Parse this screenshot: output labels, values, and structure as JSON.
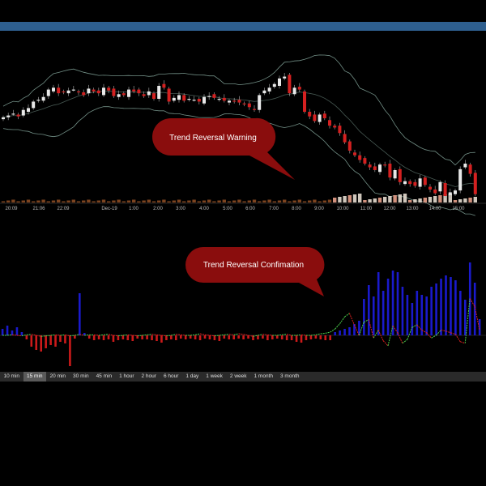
{
  "annotations": {
    "warning": "Trend Reversal Warning",
    "confirmation": "Trend Reversal Confimation"
  },
  "timeframes": [
    "10 min",
    "15 min",
    "20 min",
    "30 min",
    "45 min",
    "1 hour",
    "2 hour",
    "6 hour",
    "1 day",
    "1 week",
    "2 week",
    "1 month",
    "3 month"
  ],
  "selected_timeframe": "15 min",
  "colors": {
    "bull": "#e8e8e8",
    "bear": "#d42020",
    "bands": "#8fb3a8",
    "histogram_pos": "#1a1acc",
    "histogram_neg": "#cc1a1a",
    "signal_up": "#4cd14c",
    "signal_down": "#e02020",
    "callout": "#8a0d0d",
    "top_bar": "#2e5f8f"
  },
  "chart_data": [
    {
      "type": "candlestick",
      "x_tick_labels": [
        "20:09",
        "21:06",
        "22:09",
        "Dec-19",
        "1:00",
        "2:00",
        "3:00",
        "4:00",
        "5:00",
        "6:00",
        "7:00",
        "8:00",
        "9:00",
        "10:00",
        "11:00",
        "12:00",
        "13:00",
        "14:00",
        "15:00"
      ],
      "close": [
        182,
        184,
        186,
        183,
        190,
        192,
        199,
        201,
        204,
        212,
        214,
        208,
        209,
        211,
        212,
        209,
        206,
        213,
        210,
        208,
        214,
        211,
        205,
        207,
        206,
        212,
        210,
        208,
        205,
        210,
        202,
        216,
        214,
        199,
        203,
        206,
        200,
        202,
        201,
        199,
        204,
        205,
        203,
        202,
        200,
        200,
        199,
        198,
        196,
        193,
        190,
        206,
        211,
        214,
        218,
        224,
        226,
        208,
        214,
        212,
        188,
        183,
        178,
        185,
        181,
        173,
        171,
        165,
        155,
        146,
        141,
        136,
        132,
        128,
        125,
        131,
        130,
        117,
        125,
        112,
        113,
        110,
        108,
        116,
        109,
        104,
        100,
        112,
        97,
        101,
        103,
        126,
        132,
        121,
        99
      ],
      "series": [
        {
          "name": "Upper band"
        },
        {
          "name": "Middle band"
        },
        {
          "name": "Lower band"
        }
      ]
    },
    {
      "type": "histogram_with_signal",
      "histogram": [
        8,
        12,
        6,
        10,
        4,
        -5,
        -14,
        -18,
        -20,
        -16,
        -12,
        -14,
        -8,
        -10,
        -38,
        -4,
        52,
        3,
        -4,
        -6,
        -5,
        -6,
        -5,
        -8,
        -6,
        -5,
        -6,
        -7,
        -4,
        -5,
        -5,
        -6,
        -7,
        -9,
        -6,
        -5,
        -6,
        -4,
        -5,
        -4,
        -5,
        -6,
        -4,
        -5,
        -6,
        -7,
        -4,
        -5,
        -5,
        -4,
        -5,
        -4,
        -6,
        -5,
        -4,
        -6,
        -5,
        -4,
        -5,
        -6,
        -6,
        -8,
        -9,
        -6,
        -5,
        -4,
        -5,
        -6,
        -6,
        4,
        6,
        8,
        10,
        14,
        18,
        45,
        62,
        48,
        78,
        55,
        70,
        80,
        78,
        60,
        50,
        40,
        55,
        50,
        48,
        60,
        64,
        70,
        74,
        72,
        68,
        55,
        44,
        90,
        65,
        20
      ],
      "signal": [
        0,
        0,
        1,
        0,
        -1,
        1,
        2,
        0,
        -2,
        -1,
        0,
        1,
        0,
        1,
        -1,
        0,
        2,
        0,
        1,
        1,
        0,
        1,
        2,
        0,
        -1,
        0,
        1,
        0,
        -1,
        0,
        1,
        2,
        1,
        0,
        -1,
        0,
        2,
        1,
        0,
        0,
        1,
        3,
        1,
        0,
        -1,
        0,
        1,
        2,
        1,
        3,
        2,
        0,
        -2,
        0,
        2,
        1,
        0,
        0,
        1,
        2,
        0,
        0,
        1,
        0,
        0,
        1,
        3,
        4,
        6,
        12,
        22,
        35,
        42,
        20,
        0,
        25,
        30,
        -5,
        10,
        -10,
        -20,
        18,
        5,
        -15,
        -8,
        15,
        20,
        10,
        5,
        -5,
        0,
        10,
        8,
        5,
        2,
        -12,
        -15,
        70,
        55,
        10
      ]
    }
  ]
}
